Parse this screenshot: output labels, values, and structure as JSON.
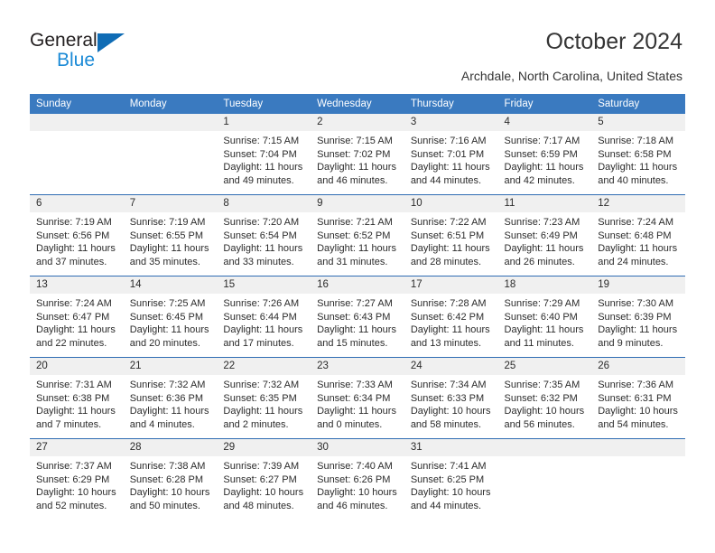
{
  "brand": {
    "name_part1": "General",
    "name_part2": "Blue",
    "color_dark": "#231f20",
    "color_blue": "#1b8ad6",
    "triangle_color": "#0f6cb5"
  },
  "header": {
    "title": "October 2024",
    "subtitle": "Archdale, North Carolina, United States"
  },
  "theme": {
    "header_row_bg": "#3a7ac0",
    "header_row_text": "#ffffff",
    "daynum_band_bg": "#f0f0f0",
    "row_separator": "#2f6cb3",
    "body_text": "#2b2b2b"
  },
  "calendar": {
    "weekday_headers": [
      "Sunday",
      "Monday",
      "Tuesday",
      "Wednesday",
      "Thursday",
      "Friday",
      "Saturday"
    ],
    "labels": {
      "sunrise": "Sunrise:",
      "sunset": "Sunset:",
      "daylight": "Daylight:"
    },
    "weeks": [
      [
        {
          "day": "",
          "sunrise": "",
          "sunset": "",
          "daylight_line1": "",
          "daylight_line2": ""
        },
        {
          "day": "",
          "sunrise": "",
          "sunset": "",
          "daylight_line1": "",
          "daylight_line2": ""
        },
        {
          "day": "1",
          "sunrise": "Sunrise: 7:15 AM",
          "sunset": "Sunset: 7:04 PM",
          "daylight_line1": "Daylight: 11 hours",
          "daylight_line2": "and 49 minutes."
        },
        {
          "day": "2",
          "sunrise": "Sunrise: 7:15 AM",
          "sunset": "Sunset: 7:02 PM",
          "daylight_line1": "Daylight: 11 hours",
          "daylight_line2": "and 46 minutes."
        },
        {
          "day": "3",
          "sunrise": "Sunrise: 7:16 AM",
          "sunset": "Sunset: 7:01 PM",
          "daylight_line1": "Daylight: 11 hours",
          "daylight_line2": "and 44 minutes."
        },
        {
          "day": "4",
          "sunrise": "Sunrise: 7:17 AM",
          "sunset": "Sunset: 6:59 PM",
          "daylight_line1": "Daylight: 11 hours",
          "daylight_line2": "and 42 minutes."
        },
        {
          "day": "5",
          "sunrise": "Sunrise: 7:18 AM",
          "sunset": "Sunset: 6:58 PM",
          "daylight_line1": "Daylight: 11 hours",
          "daylight_line2": "and 40 minutes."
        }
      ],
      [
        {
          "day": "6",
          "sunrise": "Sunrise: 7:19 AM",
          "sunset": "Sunset: 6:56 PM",
          "daylight_line1": "Daylight: 11 hours",
          "daylight_line2": "and 37 minutes."
        },
        {
          "day": "7",
          "sunrise": "Sunrise: 7:19 AM",
          "sunset": "Sunset: 6:55 PM",
          "daylight_line1": "Daylight: 11 hours",
          "daylight_line2": "and 35 minutes."
        },
        {
          "day": "8",
          "sunrise": "Sunrise: 7:20 AM",
          "sunset": "Sunset: 6:54 PM",
          "daylight_line1": "Daylight: 11 hours",
          "daylight_line2": "and 33 minutes."
        },
        {
          "day": "9",
          "sunrise": "Sunrise: 7:21 AM",
          "sunset": "Sunset: 6:52 PM",
          "daylight_line1": "Daylight: 11 hours",
          "daylight_line2": "and 31 minutes."
        },
        {
          "day": "10",
          "sunrise": "Sunrise: 7:22 AM",
          "sunset": "Sunset: 6:51 PM",
          "daylight_line1": "Daylight: 11 hours",
          "daylight_line2": "and 28 minutes."
        },
        {
          "day": "11",
          "sunrise": "Sunrise: 7:23 AM",
          "sunset": "Sunset: 6:49 PM",
          "daylight_line1": "Daylight: 11 hours",
          "daylight_line2": "and 26 minutes."
        },
        {
          "day": "12",
          "sunrise": "Sunrise: 7:24 AM",
          "sunset": "Sunset: 6:48 PM",
          "daylight_line1": "Daylight: 11 hours",
          "daylight_line2": "and 24 minutes."
        }
      ],
      [
        {
          "day": "13",
          "sunrise": "Sunrise: 7:24 AM",
          "sunset": "Sunset: 6:47 PM",
          "daylight_line1": "Daylight: 11 hours",
          "daylight_line2": "and 22 minutes."
        },
        {
          "day": "14",
          "sunrise": "Sunrise: 7:25 AM",
          "sunset": "Sunset: 6:45 PM",
          "daylight_line1": "Daylight: 11 hours",
          "daylight_line2": "and 20 minutes."
        },
        {
          "day": "15",
          "sunrise": "Sunrise: 7:26 AM",
          "sunset": "Sunset: 6:44 PM",
          "daylight_line1": "Daylight: 11 hours",
          "daylight_line2": "and 17 minutes."
        },
        {
          "day": "16",
          "sunrise": "Sunrise: 7:27 AM",
          "sunset": "Sunset: 6:43 PM",
          "daylight_line1": "Daylight: 11 hours",
          "daylight_line2": "and 15 minutes."
        },
        {
          "day": "17",
          "sunrise": "Sunrise: 7:28 AM",
          "sunset": "Sunset: 6:42 PM",
          "daylight_line1": "Daylight: 11 hours",
          "daylight_line2": "and 13 minutes."
        },
        {
          "day": "18",
          "sunrise": "Sunrise: 7:29 AM",
          "sunset": "Sunset: 6:40 PM",
          "daylight_line1": "Daylight: 11 hours",
          "daylight_line2": "and 11 minutes."
        },
        {
          "day": "19",
          "sunrise": "Sunrise: 7:30 AM",
          "sunset": "Sunset: 6:39 PM",
          "daylight_line1": "Daylight: 11 hours",
          "daylight_line2": "and 9 minutes."
        }
      ],
      [
        {
          "day": "20",
          "sunrise": "Sunrise: 7:31 AM",
          "sunset": "Sunset: 6:38 PM",
          "daylight_line1": "Daylight: 11 hours",
          "daylight_line2": "and 7 minutes."
        },
        {
          "day": "21",
          "sunrise": "Sunrise: 7:32 AM",
          "sunset": "Sunset: 6:36 PM",
          "daylight_line1": "Daylight: 11 hours",
          "daylight_line2": "and 4 minutes."
        },
        {
          "day": "22",
          "sunrise": "Sunrise: 7:32 AM",
          "sunset": "Sunset: 6:35 PM",
          "daylight_line1": "Daylight: 11 hours",
          "daylight_line2": "and 2 minutes."
        },
        {
          "day": "23",
          "sunrise": "Sunrise: 7:33 AM",
          "sunset": "Sunset: 6:34 PM",
          "daylight_line1": "Daylight: 11 hours",
          "daylight_line2": "and 0 minutes."
        },
        {
          "day": "24",
          "sunrise": "Sunrise: 7:34 AM",
          "sunset": "Sunset: 6:33 PM",
          "daylight_line1": "Daylight: 10 hours",
          "daylight_line2": "and 58 minutes."
        },
        {
          "day": "25",
          "sunrise": "Sunrise: 7:35 AM",
          "sunset": "Sunset: 6:32 PM",
          "daylight_line1": "Daylight: 10 hours",
          "daylight_line2": "and 56 minutes."
        },
        {
          "day": "26",
          "sunrise": "Sunrise: 7:36 AM",
          "sunset": "Sunset: 6:31 PM",
          "daylight_line1": "Daylight: 10 hours",
          "daylight_line2": "and 54 minutes."
        }
      ],
      [
        {
          "day": "27",
          "sunrise": "Sunrise: 7:37 AM",
          "sunset": "Sunset: 6:29 PM",
          "daylight_line1": "Daylight: 10 hours",
          "daylight_line2": "and 52 minutes."
        },
        {
          "day": "28",
          "sunrise": "Sunrise: 7:38 AM",
          "sunset": "Sunset: 6:28 PM",
          "daylight_line1": "Daylight: 10 hours",
          "daylight_line2": "and 50 minutes."
        },
        {
          "day": "29",
          "sunrise": "Sunrise: 7:39 AM",
          "sunset": "Sunset: 6:27 PM",
          "daylight_line1": "Daylight: 10 hours",
          "daylight_line2": "and 48 minutes."
        },
        {
          "day": "30",
          "sunrise": "Sunrise: 7:40 AM",
          "sunset": "Sunset: 6:26 PM",
          "daylight_line1": "Daylight: 10 hours",
          "daylight_line2": "and 46 minutes."
        },
        {
          "day": "31",
          "sunrise": "Sunrise: 7:41 AM",
          "sunset": "Sunset: 6:25 PM",
          "daylight_line1": "Daylight: 10 hours",
          "daylight_line2": "and 44 minutes."
        },
        {
          "day": "",
          "sunrise": "",
          "sunset": "",
          "daylight_line1": "",
          "daylight_line2": ""
        },
        {
          "day": "",
          "sunrise": "",
          "sunset": "",
          "daylight_line1": "",
          "daylight_line2": ""
        }
      ]
    ]
  }
}
